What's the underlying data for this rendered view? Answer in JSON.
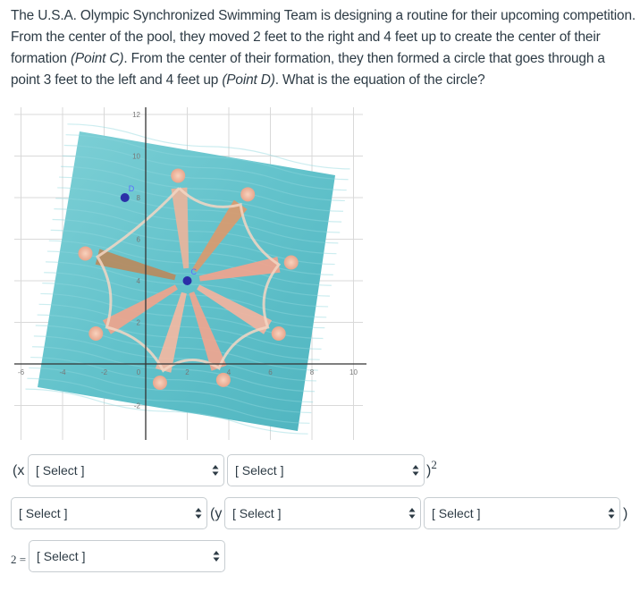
{
  "question": {
    "part1": "The U.S.A. Olympic Synchronized Swimming Team is designing a routine for their upcoming competition.  From the center of the pool, they moved 2 feet to the right and 4 feet up to create the center of their formation ",
    "pointC": "(Point C)",
    "part2": ".  From the center of their formation, they then formed a circle that goes through a point 3 feet to the left and 4 feet up ",
    "pointD": "(Point D)",
    "part3": ".  What is the equation of the circle?"
  },
  "chart_data": {
    "type": "scatter",
    "title": "",
    "xlabel": "",
    "ylabel": "",
    "x_ticks": [
      "-6",
      "-4",
      "-2",
      "0",
      "2",
      "4",
      "6",
      "8",
      "10"
    ],
    "y_ticks": [
      "12",
      "10",
      "8",
      "6",
      "4",
      "2",
      "0",
      "-2"
    ],
    "xlim": [
      -6,
      10
    ],
    "ylim": [
      -2,
      12
    ],
    "grid": true,
    "background": "Pool image with eight synchronized swimmers in a circular formation",
    "points": [
      {
        "name": "C",
        "x": 2,
        "y": 4,
        "color": "#2b2fa8"
      },
      {
        "name": "D",
        "x": -1,
        "y": 8,
        "color": "#2b2fa8"
      }
    ]
  },
  "equation": {
    "open_x": "(x",
    "close_sq": ")",
    "sq": "2",
    "open_y": "(y",
    "close_paren": ")",
    "rhs": "2 =",
    "selects": [
      {
        "value": "[ Select ]"
      },
      {
        "value": "[ Select ]"
      },
      {
        "value": "[ Select ]"
      },
      {
        "value": "[ Select ]"
      },
      {
        "value": "[ Select ]"
      },
      {
        "value": "[ Select ]"
      }
    ]
  },
  "colors": {
    "pool": "#5fc0c8",
    "point": "#2b2fa8",
    "grid": "#d9d9d9",
    "axis": "#333333"
  }
}
